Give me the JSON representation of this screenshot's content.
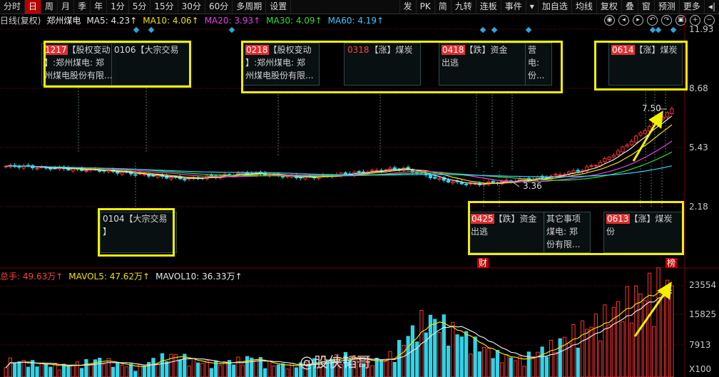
{
  "toolbar": {
    "periods": [
      "分时",
      "日",
      "周",
      "月",
      "季",
      "年",
      "1分",
      "5分",
      "15分",
      "30分",
      "60分",
      "多周期",
      "设置"
    ],
    "active": "日",
    "right_items": [
      "发",
      "PK",
      "简",
      "九转",
      "连板",
      "事件",
      "▾",
      "加自选",
      "均线",
      "复权",
      "叠",
      "窗",
      "预测",
      "更多",
      "◂|"
    ]
  },
  "header": {
    "chart_mode": "日线(复权)",
    "stock_name": "郑州煤电",
    "ma5": "MA5: 4.23↑",
    "ma10": "MA10: 4.06↑",
    "ma20": "MA20: 3.93↑",
    "ma30": "MA30: 4.09↑",
    "ma60": "MA60: 4.19↑"
  },
  "price_axis": [
    "11.93",
    "8.68",
    "5.43",
    "2.18"
  ],
  "price_annotations": {
    "high": "7.50",
    "low": "3.36"
  },
  "events_top": [
    {
      "date": "1217",
      "text": "【股权变动",
      "line2": "】:郑州煤电: 郑",
      "line3": "州煤电股份有限..."
    },
    {
      "date": "0106",
      "text": "【大宗交易"
    },
    {
      "date": "0218",
      "text": "【股权变动",
      "line2": "】:郑州煤电: 郑",
      "line3": "州煤电股份有限..."
    },
    {
      "date": "0318",
      "text": "【涨】煤炭"
    },
    {
      "date": "0418",
      "text": "【跌】资金",
      "line2": "出逃"
    },
    {
      "date": "",
      "text": "营",
      "line2": "电:",
      "line3": "份..."
    },
    {
      "date": "0614",
      "text": "【涨】煤炭"
    }
  ],
  "events_bottom": [
    {
      "date": "0104",
      "text": "【大宗交易",
      "line2": "】"
    },
    {
      "date": "0425",
      "text": "【跌】资金",
      "line2": "出逃"
    },
    {
      "date": "",
      "text": "其它事项",
      "line2": "煤电: 郑",
      "line3": "份有限..."
    },
    {
      "date": "0613",
      "text": "【涨】煤炭",
      "line2": "份"
    }
  ],
  "tags": {
    "cai": "财",
    "bang": "榜"
  },
  "volume_header": {
    "total": "总手: 49.63万↑",
    "mavol5": "MAVOL5: 47.62万↑",
    "mavol10": "MAVOL10: 36.33万↑"
  },
  "volume_axis": [
    "23554",
    "15825",
    "7913",
    "X100"
  ],
  "watermark": "@股侠韬哥",
  "colors": {
    "up": "#ff3232",
    "down": "#32d2e6",
    "ma5": "#e6e6e6",
    "ma10": "#f0e000",
    "ma20": "#e640e6",
    "ma30": "#30e030",
    "ma60": "#40c8ff",
    "annotation": "#f0f000"
  },
  "chart_data": {
    "type": "candlestick",
    "ylim": [
      2.18,
      11.93
    ],
    "close_samples": [
      4.4,
      4.4,
      4.3,
      4.3,
      4.2,
      4.2,
      4.1,
      4.0,
      3.9,
      3.8,
      3.7,
      3.8,
      3.9,
      4.0,
      4.0,
      3.9,
      3.8,
      3.8,
      3.9,
      4.0,
      4.1,
      4.2,
      4.3,
      4.0,
      3.7,
      3.5,
      3.4,
      3.5,
      3.6,
      3.7,
      3.8,
      4.0,
      4.2,
      4.6,
      5.2,
      6.0,
      6.8,
      7.5
    ],
    "volume_samples": [
      4000,
      3500,
      3000,
      2600,
      3300,
      4200,
      2900,
      2400,
      4500,
      5200,
      3600,
      3200,
      3800,
      4600,
      3000,
      2700,
      3500,
      4400,
      5000,
      3800,
      4200,
      9000,
      14000,
      12500,
      10000,
      7000,
      5000,
      4200,
      6000,
      8000,
      11000,
      13000,
      16000,
      19000,
      21500,
      23554
    ]
  }
}
